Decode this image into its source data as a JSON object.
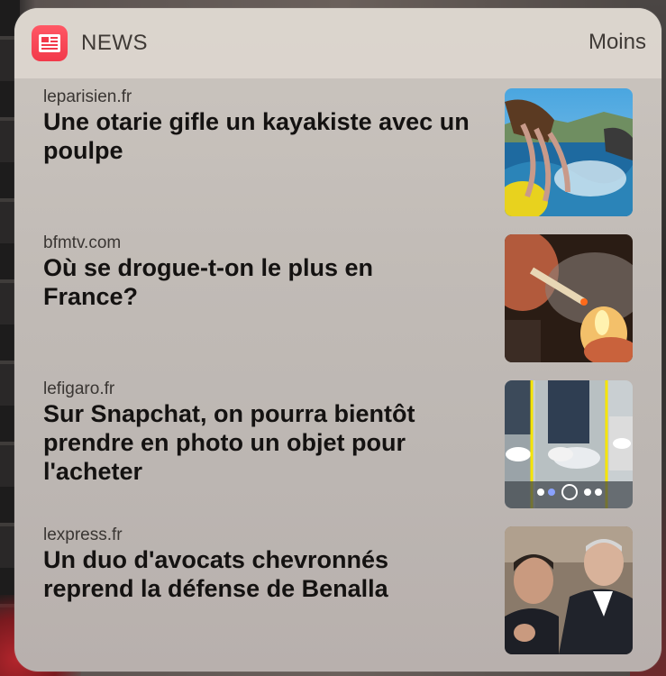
{
  "widget": {
    "app_name": "NEWS",
    "less_label": "Moins",
    "app_icon": "news-app-icon"
  },
  "items": [
    {
      "source": "leparisien.fr",
      "headline": "Une otarie gifle un kayakiste avec un poulpe",
      "image": "seal-octopus-kayak-photo"
    },
    {
      "source": "bfmtv.com",
      "headline": "Où se drogue-t-on le plus en France?",
      "image": "joint-lighter-photo"
    },
    {
      "source": "lefigaro.fr",
      "headline": "Sur Snapchat, on pourra bientôt prendre en photo un objet pour l'acheter",
      "image": "snapchat-shoes-scan-photo"
    },
    {
      "source": "lexpress.fr",
      "headline": "Un duo d'avocats chevronnés reprend la défense de Benalla",
      "image": "lawyers-hearing-photo"
    }
  ]
}
